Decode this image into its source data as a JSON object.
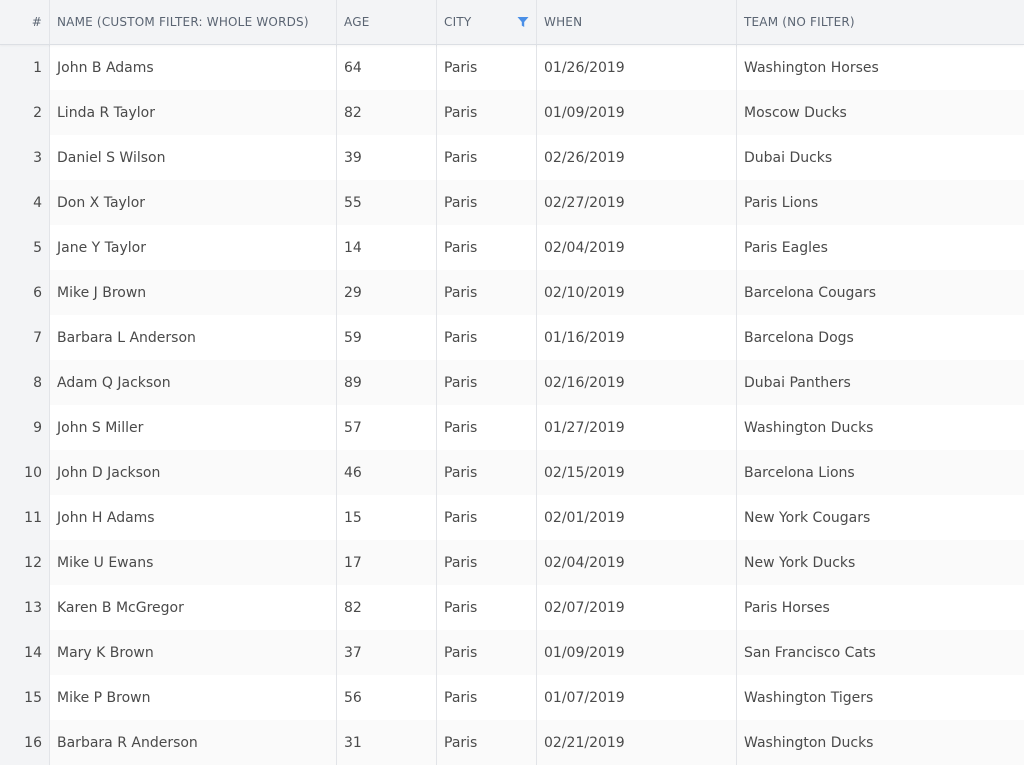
{
  "columns": {
    "num": "#",
    "name": "NAME (CUSTOM FILTER: WHOLE WORDS)",
    "age": "AGE",
    "city": "CITY",
    "when": "WHEN",
    "team": "TEAM (NO FILTER)"
  },
  "filter_icon": {
    "icon": "funnel-filter-icon",
    "color": "#4a8fe7"
  },
  "rows": [
    {
      "num": "1",
      "name": "John B Adams",
      "age": "64",
      "city": "Paris",
      "when": "01/26/2019",
      "team": "Washington Horses"
    },
    {
      "num": "2",
      "name": "Linda R Taylor",
      "age": "82",
      "city": "Paris",
      "when": "01/09/2019",
      "team": "Moscow Ducks"
    },
    {
      "num": "3",
      "name": "Daniel S Wilson",
      "age": "39",
      "city": "Paris",
      "when": "02/26/2019",
      "team": "Dubai Ducks"
    },
    {
      "num": "4",
      "name": "Don X Taylor",
      "age": "55",
      "city": "Paris",
      "when": "02/27/2019",
      "team": "Paris Lions"
    },
    {
      "num": "5",
      "name": "Jane Y Taylor",
      "age": "14",
      "city": "Paris",
      "when": "02/04/2019",
      "team": "Paris Eagles"
    },
    {
      "num": "6",
      "name": "Mike J Brown",
      "age": "29",
      "city": "Paris",
      "when": "02/10/2019",
      "team": "Barcelona Cougars"
    },
    {
      "num": "7",
      "name": "Barbara L Anderson",
      "age": "59",
      "city": "Paris",
      "when": "01/16/2019",
      "team": "Barcelona Dogs"
    },
    {
      "num": "8",
      "name": "Adam Q Jackson",
      "age": "89",
      "city": "Paris",
      "when": "02/16/2019",
      "team": "Dubai Panthers"
    },
    {
      "num": "9",
      "name": "John S Miller",
      "age": "57",
      "city": "Paris",
      "when": "01/27/2019",
      "team": "Washington Ducks"
    },
    {
      "num": "10",
      "name": "John D Jackson",
      "age": "46",
      "city": "Paris",
      "when": "02/15/2019",
      "team": "Barcelona Lions"
    },
    {
      "num": "11",
      "name": "John H Adams",
      "age": "15",
      "city": "Paris",
      "when": "02/01/2019",
      "team": "New York Cougars"
    },
    {
      "num": "12",
      "name": "Mike U Ewans",
      "age": "17",
      "city": "Paris",
      "when": "02/04/2019",
      "team": "New York Ducks"
    },
    {
      "num": "13",
      "name": "Karen B McGregor",
      "age": "82",
      "city": "Paris",
      "when": "02/07/2019",
      "team": "Paris Horses"
    },
    {
      "num": "14",
      "name": "Mary K Brown",
      "age": "37",
      "city": "Paris",
      "when": "01/09/2019",
      "team": "San Francisco Cats"
    },
    {
      "num": "15",
      "name": "Mike P Brown",
      "age": "56",
      "city": "Paris",
      "when": "01/07/2019",
      "team": "Washington Tigers"
    },
    {
      "num": "16",
      "name": "Barbara R Anderson",
      "age": "31",
      "city": "Paris",
      "when": "02/21/2019",
      "team": "Washington Ducks"
    }
  ]
}
